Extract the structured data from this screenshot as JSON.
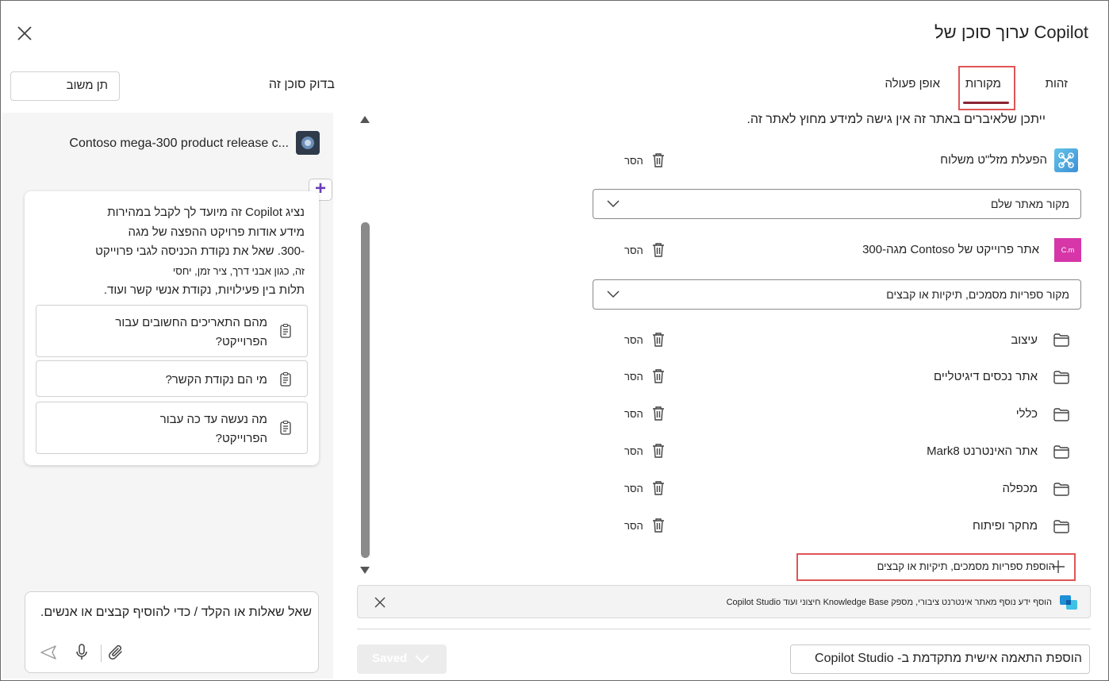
{
  "window": {
    "title": "ערוך סוכן של Copilot"
  },
  "tabs": [
    {
      "label": "זהות"
    },
    {
      "label": "מקורות"
    },
    {
      "label": "אופן פעולה"
    }
  ],
  "test_pane": {
    "label": "בדוק סוכן זה",
    "feedback_button": "תן משוב",
    "agent_name": "Contoso mega-300 product release c...",
    "intro_line1": "נציג Copilot זה מיועד לך לקבל במהירות",
    "intro_line2": "מידע אודות פרויקט ההפצה של מגה",
    "intro_line3": "-300. שאל את נקודת הכניסה לגבי פרוייקט",
    "intro_line4": "זה, כגון אבני דרך, ציר זמן, יחסי",
    "intro_line5": "תלות בין פעילויות, נקודת אנשי קשר ועוד.",
    "prompts": [
      {
        "line1": "מהם התאריכים החשובים עבור",
        "line2": "הפרוייקט?"
      },
      {
        "line1": "מי הם נקודת הקשר?",
        "line2": ""
      },
      {
        "line1": "מה נעשה עד כה עבור",
        "line2": "הפרוייקט?"
      }
    ],
    "chat_placeholder": "שאל שאלות או הקלד / כדי להוסיף קבצים או אנשים."
  },
  "sources": {
    "notice": "ייתכן שלאיברים באתר זה אין גישה למידע מחוץ לאתר זה.",
    "remove_label": "הסר",
    "copilot_item": "הפעלת מזל\"ט משלוח",
    "dropdown_site": "מקור מאתר שלם",
    "site_item": "אתר פרוייקט של Contoso מגה-300",
    "site_badge": "C.m",
    "dropdown_libraries": "מקור ספריות מסמכים, תיקיות או קבצים",
    "folders": [
      {
        "name": "עיצוב"
      },
      {
        "name": "אתר נכסים דיגיטליים"
      },
      {
        "name": "כללי"
      },
      {
        "name": "אתר האינטרנט Mark8"
      },
      {
        "name": "מכפלה"
      },
      {
        "name": "מחקר ופיתוח"
      }
    ],
    "add_button": "הוספת ספריות מסמכים, תיקיות או קבצים",
    "banner": "הוסף ידע נוסף מאתר אינטרנט ציבורי, מספק Knowledge Base חיצוני ועוד Copilot Studio",
    "saved_button": "Saved",
    "advanced_button": "הוספת התאמה אישית מתקדמת ב- Copilot Studio"
  },
  "colors": {
    "accent_purple": "#6b3fb8",
    "tab_underline": "#8a2433",
    "highlight": "#e05555"
  }
}
